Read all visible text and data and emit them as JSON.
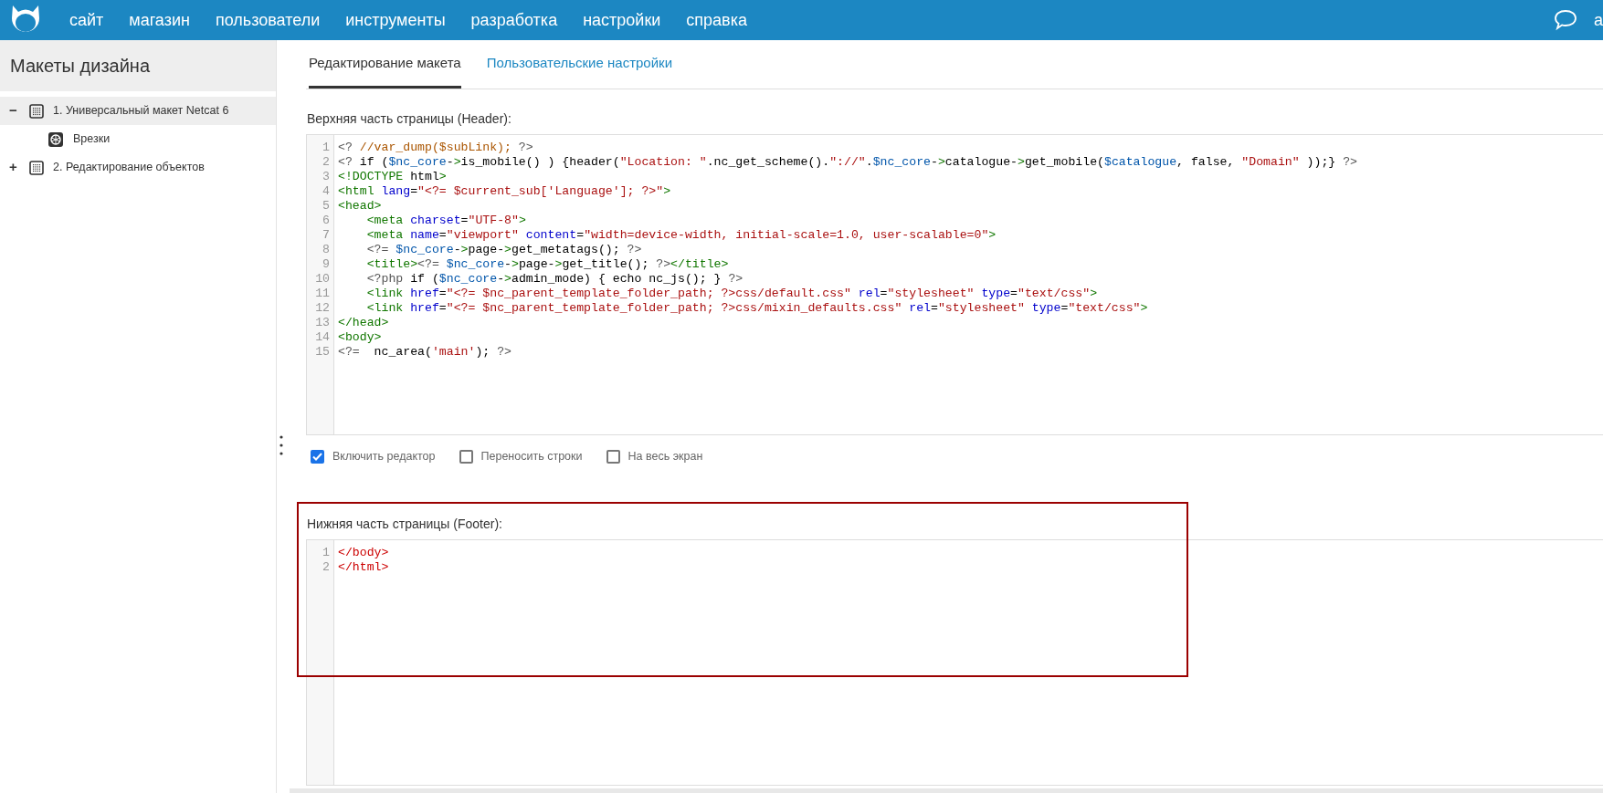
{
  "navbar": {
    "menu": [
      {
        "label": "сайт"
      },
      {
        "label": "магазин"
      },
      {
        "label": "пользователи"
      },
      {
        "label": "инструменты"
      },
      {
        "label": "разработка"
      },
      {
        "label": "настройки"
      },
      {
        "label": "справка"
      }
    ],
    "user": "a"
  },
  "sidebar": {
    "title": "Макеты дизайна",
    "tree": [
      {
        "toggle": "−",
        "label": "1. Универсальный макет Netcat 6",
        "selected": true,
        "kind": "template",
        "children": [
          {
            "label": "Врезки",
            "selected": false,
            "kind": "block"
          }
        ]
      },
      {
        "toggle": "+",
        "label": "2. Редактирование объектов",
        "selected": false,
        "kind": "template"
      }
    ]
  },
  "tabs": [
    {
      "label": "Редактирование макета",
      "selected": true
    },
    {
      "label": "Пользовательские настройки",
      "selected": false
    }
  ],
  "header_section": {
    "label": "Верхняя часть страницы (Header):",
    "lines": [
      {
        "n": "1",
        "code": "<? //var_dump($subLink); ?>"
      },
      {
        "n": "2",
        "code": "<? if ($nc_core->is_mobile() ) {header(\"Location: \".nc_get_scheme().\"://\".$nc_core->catalogue->get_mobile($catalogue, false, \"Domain\" ));} ?>"
      },
      {
        "n": "3",
        "code": "<!DOCTYPE html>"
      },
      {
        "n": "4",
        "code": "<html lang=\"<?= $current_sub['Language']; ?>\">"
      },
      {
        "n": "5",
        "code": "<head>"
      },
      {
        "n": "6",
        "code": "    <meta charset=\"UTF-8\">"
      },
      {
        "n": "7",
        "code": "    <meta name=\"viewport\" content=\"width=device-width, initial-scale=1.0, user-scalable=0\">"
      },
      {
        "n": "8",
        "code": "    <?= $nc_core->page->get_metatags(); ?>"
      },
      {
        "n": "9",
        "code": "    <title><?= $nc_core->page->get_title(); ?></title>"
      },
      {
        "n": "10",
        "code": "    <?php if ($nc_core->admin_mode) { echo nc_js(); } ?>"
      },
      {
        "n": "11",
        "code": "    <link href=\"<?= $nc_parent_template_folder_path; ?>css/default.css\" rel=\"stylesheet\" type=\"text/css\">"
      },
      {
        "n": "12",
        "code": "    <link href=\"<?= $nc_parent_template_folder_path; ?>css/mixin_defaults.css\" rel=\"stylesheet\" type=\"text/css\">"
      },
      {
        "n": "13",
        "code": "</head>"
      },
      {
        "n": "14",
        "code": "<body>"
      },
      {
        "n": "15",
        "code": "<?=  nc_area('main'); ?>"
      }
    ],
    "options": [
      {
        "label": "Включить редактор",
        "checked": true
      },
      {
        "label": "Переносить строки",
        "checked": false
      },
      {
        "label": "На весь экран",
        "checked": false
      }
    ]
  },
  "footer_section": {
    "label": "Нижняя часть страницы (Footer):",
    "highlighted": true,
    "tags_error": true,
    "lines": [
      {
        "n": "1",
        "code": "</body>"
      },
      {
        "n": "2",
        "code": "</html>"
      }
    ]
  }
}
